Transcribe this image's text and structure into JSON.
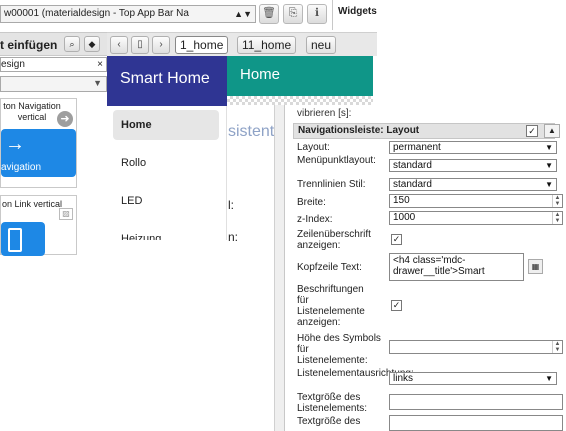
{
  "topbar": {
    "view_select": "w00001 (materialdesign - Top App Bar Na",
    "widgets_label": "Widgets"
  },
  "palette": {
    "title": "t einfügen",
    "filter": "esign",
    "clear": "×",
    "cards": [
      {
        "title": "ton Navigation vertical",
        "tile_label": "avigation"
      },
      {
        "title": "on Link vertical"
      }
    ]
  },
  "tabs": {
    "items": [
      {
        "label": "1_home",
        "active": true
      },
      {
        "label": "11_home",
        "active": false
      },
      {
        "label": "neu",
        "active": false
      }
    ]
  },
  "canvas": {
    "appbar_title": "Home",
    "drawer_title": "Smart Home",
    "drawer_items": [
      "Home",
      "Rollo",
      "LED",
      "Heizung"
    ],
    "bg_text1": "sistent",
    "bg_text2": "l:",
    "bg_text3": "n:",
    "colors": {
      "appbar": "#0f9688",
      "drawer_header": "#2f3593",
      "active_item": "#e6e6e6"
    }
  },
  "properties": {
    "prev_label": "vibrieren [s]:",
    "group_title": "Navigationsleiste: Layout",
    "rows": {
      "layout_label": "Layout:",
      "layout_value": "permanent",
      "menu_layout_label": "Menüpunktlayout:",
      "menu_layout_value": "standard",
      "divider_label": "Trennlinien Stil:",
      "divider_value": "standard",
      "width_label": "Breite:",
      "width_value": "150",
      "zindex_label": "z-Index:",
      "zindex_value": "1000",
      "row_header_label": "Zeilenüberschrift anzeigen:",
      "header_text_label": "Kopfzeile Text:",
      "header_text_value": "<h4 class='mdc-drawer__title'>Smart",
      "captions_label": "Beschriftungen für Listenelemente anzeigen:",
      "icon_height_label": "Höhe des Symbols für Listenelemente:",
      "alignment_label": "Listenelementausrichtung:",
      "alignment_value": "links",
      "font_size_label": "Textgröße des Listenelements:",
      "font_size_label2": "Textgröße des"
    }
  }
}
